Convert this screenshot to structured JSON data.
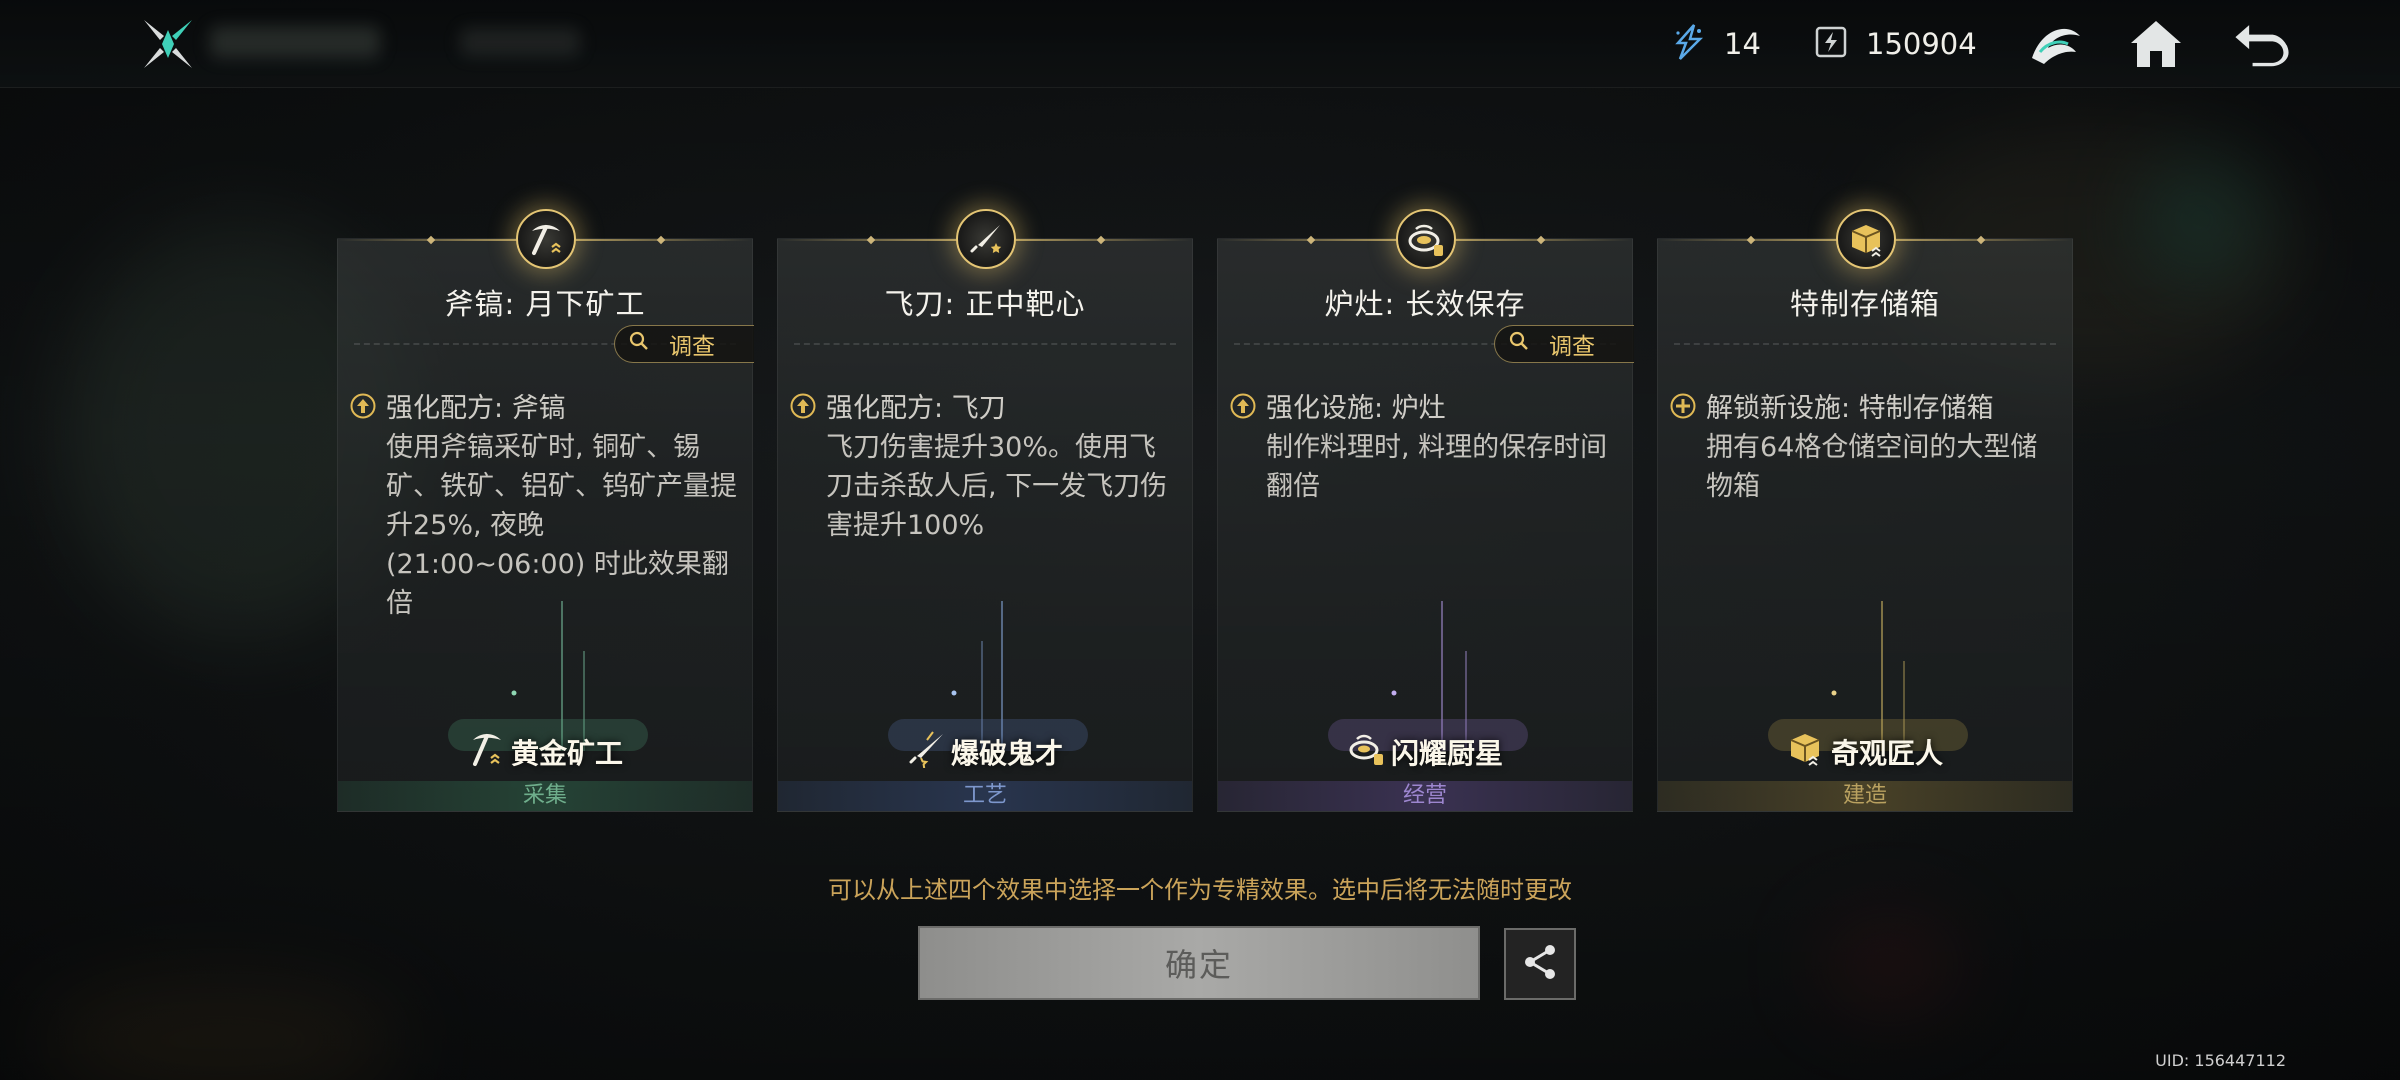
{
  "header": {
    "currency_1": {
      "icon": "energy-crystal-icon",
      "value": "14"
    },
    "currency_2": {
      "icon": "token-icon",
      "value": "150904"
    },
    "buttons": [
      "faction-emblem-icon",
      "home-icon",
      "back-icon"
    ]
  },
  "cards": [
    {
      "title": "斧镐: 月下矿工",
      "icon": "pickaxe-icon",
      "investigate_label": "调查",
      "effect_type": "upgrade",
      "effect_head": "强化配方: 斧镐",
      "effect_body": "使用斧镐采矿时, 铜矿、锡矿、铁矿、铝矿、钨矿产量提升25%, 夜晚 (21:00~06:00) 时此效果翻倍",
      "talent": "黄金矿工",
      "category": "采集",
      "accent": "#4f9a78"
    },
    {
      "title": "飞刀: 正中靶心",
      "icon": "throwing-knife-icon",
      "investigate_label": "",
      "effect_type": "upgrade",
      "effect_head": "强化配方: 飞刀",
      "effect_body": "飞刀伤害提升30%。使用飞刀击杀敌人后, 下一发飞刀伤害提升100%",
      "talent": "爆破鬼才",
      "category": "工艺",
      "accent": "#5a78b4"
    },
    {
      "title": "炉灶: 长效保存",
      "icon": "stove-icon",
      "investigate_label": "调查",
      "effect_type": "upgrade",
      "effect_head": "强化设施: 炉灶",
      "effect_body": "制作料理时, 料理的保存时间翻倍",
      "talent": "闪耀厨星",
      "category": "经营",
      "accent": "#8a70c0"
    },
    {
      "title": "特制存储箱",
      "icon": "storage-box-icon",
      "investigate_label": "",
      "effect_type": "unlock",
      "effect_head": "解锁新设施: 特制存储箱",
      "effect_body": "拥有64格仓储空间的大型储物箱",
      "talent": "奇观匠人",
      "category": "建造",
      "accent": "#b39a4a"
    }
  ],
  "footer": {
    "hint": "可以从上述四个效果中选择一个作为专精效果。选中后将无法随时更改",
    "confirm_label": "确定",
    "share_icon": "share-icon",
    "uid": "UID: 156447112"
  }
}
